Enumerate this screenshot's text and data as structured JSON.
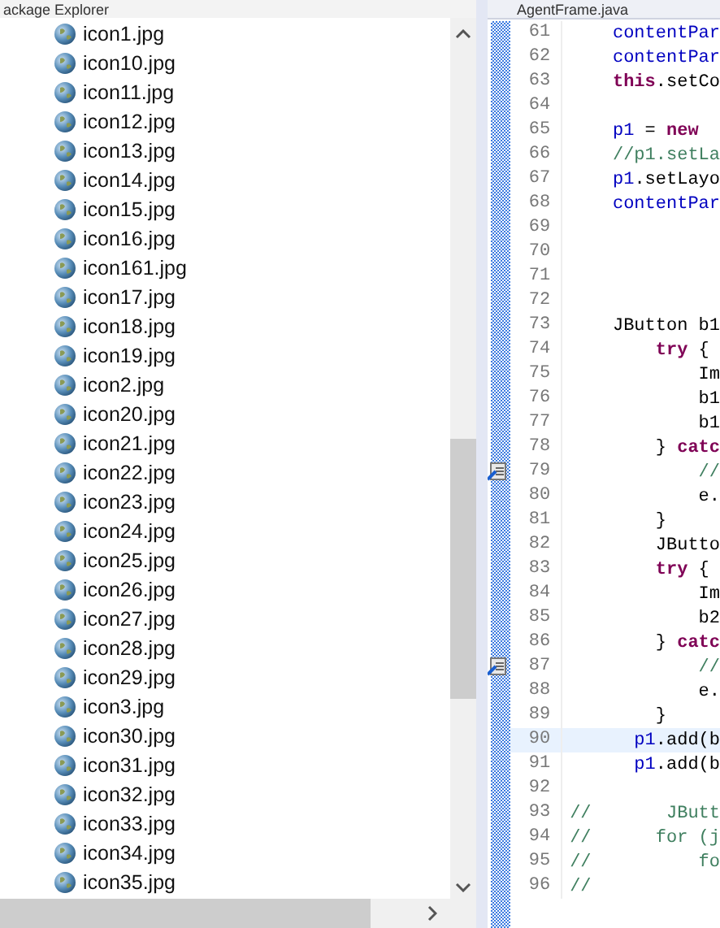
{
  "explorer": {
    "title": "ackage Explorer",
    "files": [
      {
        "name": "icon1.jpg"
      },
      {
        "name": "icon10.jpg"
      },
      {
        "name": "icon11.jpg"
      },
      {
        "name": "icon12.jpg"
      },
      {
        "name": "icon13.jpg"
      },
      {
        "name": "icon14.jpg"
      },
      {
        "name": "icon15.jpg"
      },
      {
        "name": "icon16.jpg"
      },
      {
        "name": "icon161.jpg"
      },
      {
        "name": "icon17.jpg"
      },
      {
        "name": "icon18.jpg"
      },
      {
        "name": "icon19.jpg"
      },
      {
        "name": "icon2.jpg"
      },
      {
        "name": "icon20.jpg"
      },
      {
        "name": "icon21.jpg"
      },
      {
        "name": "icon22.jpg"
      },
      {
        "name": "icon23.jpg"
      },
      {
        "name": "icon24.jpg"
      },
      {
        "name": "icon25.jpg"
      },
      {
        "name": "icon26.jpg"
      },
      {
        "name": "icon27.jpg"
      },
      {
        "name": "icon28.jpg"
      },
      {
        "name": "icon29.jpg"
      },
      {
        "name": "icon3.jpg"
      },
      {
        "name": "icon30.jpg"
      },
      {
        "name": "icon31.jpg"
      },
      {
        "name": "icon32.jpg"
      },
      {
        "name": "icon33.jpg"
      },
      {
        "name": "icon34.jpg"
      },
      {
        "name": "icon35.jpg"
      }
    ]
  },
  "editor": {
    "tab": "AgentFrame.java",
    "lines": [
      {
        "number": "61",
        "marker": false,
        "current": false,
        "tokens": [
          {
            "text": "    contentPar",
            "kind": "field"
          }
        ]
      },
      {
        "number": "62",
        "marker": false,
        "current": false,
        "tokens": [
          {
            "text": "    contentPar",
            "kind": "field"
          }
        ]
      },
      {
        "number": "63",
        "marker": false,
        "current": false,
        "tokens": [
          {
            "text": "    this",
            "kind": "keyword"
          },
          {
            "text": ".setCo",
            "kind": "plain"
          }
        ]
      },
      {
        "number": "64",
        "marker": false,
        "current": false
      },
      {
        "number": "65",
        "marker": false,
        "current": false,
        "tokens": [
          {
            "text": "    p1",
            "kind": "field"
          },
          {
            "text": " = ",
            "kind": "plain"
          },
          {
            "text": "new",
            "kind": "keyword"
          }
        ]
      },
      {
        "number": "66",
        "marker": false,
        "current": false,
        "tokens": [
          {
            "text": "    //p1.setLa",
            "kind": "comment"
          }
        ]
      },
      {
        "number": "67",
        "marker": false,
        "current": false,
        "tokens": [
          {
            "text": "    p1",
            "kind": "field"
          },
          {
            "text": ".setLayo",
            "kind": "plain"
          }
        ]
      },
      {
        "number": "68",
        "marker": false,
        "current": false,
        "tokens": [
          {
            "text": "    contentPar",
            "kind": "field"
          }
        ]
      },
      {
        "number": "69",
        "marker": false,
        "current": false
      },
      {
        "number": "70",
        "marker": false,
        "current": false
      },
      {
        "number": "71",
        "marker": false,
        "current": false
      },
      {
        "number": "72",
        "marker": false,
        "current": false
      },
      {
        "number": "73",
        "marker": false,
        "current": false,
        "tokens": [
          {
            "text": "    JButton b1",
            "kind": "plain"
          }
        ]
      },
      {
        "number": "74",
        "marker": false,
        "current": false,
        "tokens": [
          {
            "text": "        try",
            "kind": "keyword"
          },
          {
            "text": " {",
            "kind": "plain"
          }
        ]
      },
      {
        "number": "75",
        "marker": false,
        "current": false,
        "tokens": [
          {
            "text": "            Im",
            "kind": "plain"
          }
        ]
      },
      {
        "number": "76",
        "marker": false,
        "current": false,
        "tokens": [
          {
            "text": "            b1",
            "kind": "plain"
          }
        ]
      },
      {
        "number": "77",
        "marker": false,
        "current": false,
        "tokens": [
          {
            "text": "            b1",
            "kind": "plain"
          }
        ]
      },
      {
        "number": "78",
        "marker": false,
        "current": false,
        "tokens": [
          {
            "text": "        } ",
            "kind": "plain"
          },
          {
            "text": "catc",
            "kind": "keyword"
          }
        ]
      },
      {
        "number": "79",
        "marker": true,
        "current": false,
        "tokens": [
          {
            "text": "            //",
            "kind": "comment"
          }
        ]
      },
      {
        "number": "80",
        "marker": false,
        "current": false,
        "tokens": [
          {
            "text": "            e.",
            "kind": "plain"
          }
        ]
      },
      {
        "number": "81",
        "marker": false,
        "current": false,
        "tokens": [
          {
            "text": "        }",
            "kind": "plain"
          }
        ]
      },
      {
        "number": "82",
        "marker": false,
        "current": false,
        "tokens": [
          {
            "text": "        JButto",
            "kind": "plain"
          }
        ]
      },
      {
        "number": "83",
        "marker": false,
        "current": false,
        "tokens": [
          {
            "text": "        try",
            "kind": "keyword"
          },
          {
            "text": " {",
            "kind": "plain"
          }
        ]
      },
      {
        "number": "84",
        "marker": false,
        "current": false,
        "tokens": [
          {
            "text": "            Im",
            "kind": "plain"
          }
        ]
      },
      {
        "number": "85",
        "marker": false,
        "current": false,
        "tokens": [
          {
            "text": "            b2",
            "kind": "plain"
          }
        ]
      },
      {
        "number": "86",
        "marker": false,
        "current": false,
        "tokens": [
          {
            "text": "        } ",
            "kind": "plain"
          },
          {
            "text": "catc",
            "kind": "keyword"
          }
        ]
      },
      {
        "number": "87",
        "marker": true,
        "current": false,
        "tokens": [
          {
            "text": "            //",
            "kind": "comment"
          }
        ]
      },
      {
        "number": "88",
        "marker": false,
        "current": false,
        "tokens": [
          {
            "text": "            e.",
            "kind": "plain"
          }
        ]
      },
      {
        "number": "89",
        "marker": false,
        "current": false,
        "tokens": [
          {
            "text": "        }",
            "kind": "plain"
          }
        ]
      },
      {
        "number": "90",
        "marker": false,
        "current": true,
        "tokens": [
          {
            "text": "      p1",
            "kind": "field"
          },
          {
            "text": ".add(b",
            "kind": "plain"
          }
        ]
      },
      {
        "number": "91",
        "marker": false,
        "current": false,
        "tokens": [
          {
            "text": "      p1",
            "kind": "field"
          },
          {
            "text": ".add(b",
            "kind": "plain"
          }
        ]
      },
      {
        "number": "92",
        "marker": false,
        "current": false
      },
      {
        "number": "93",
        "marker": false,
        "current": false,
        "tokens": [
          {
            "text": "//       JButt",
            "kind": "comment"
          }
        ]
      },
      {
        "number": "94",
        "marker": false,
        "current": false,
        "tokens": [
          {
            "text": "//      for (j",
            "kind": "comment"
          }
        ]
      },
      {
        "number": "95",
        "marker": false,
        "current": false,
        "tokens": [
          {
            "text": "//          fo",
            "kind": "comment"
          }
        ]
      },
      {
        "number": "96",
        "marker": false,
        "current": false,
        "tokens": [
          {
            "text": "//",
            "kind": "comment"
          }
        ]
      }
    ]
  }
}
